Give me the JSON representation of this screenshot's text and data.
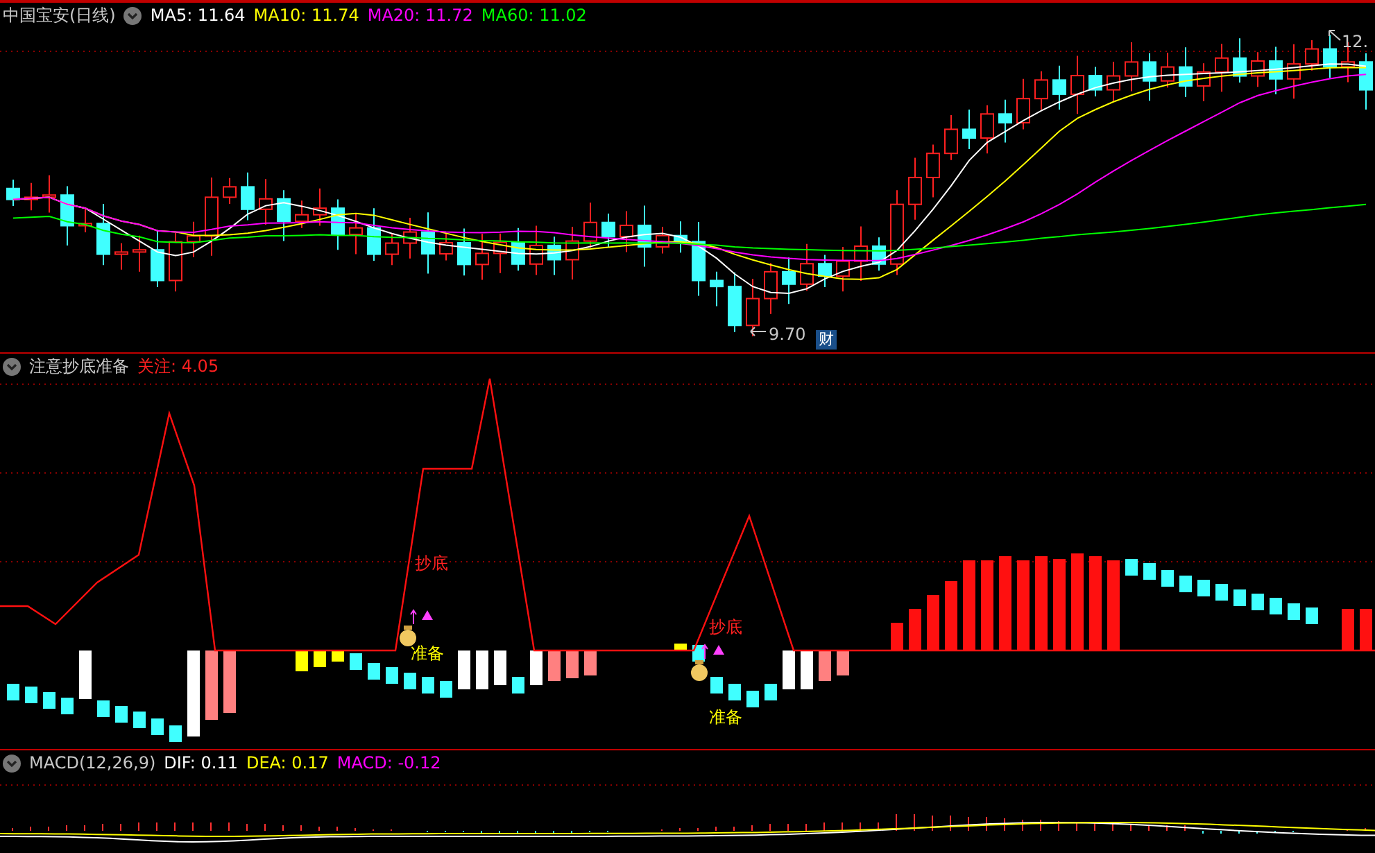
{
  "main_panel": {
    "title": "中国宝安(日线)",
    "indicators": [
      {
        "label": "MA5: 11.64",
        "color": "#ffffff"
      },
      {
        "label": "MA10: 11.74",
        "color": "#ffff00"
      },
      {
        "label": "MA20: 11.72",
        "color": "#ff00ff"
      },
      {
        "label": "MA60: 11.02",
        "color": "#00ff00"
      }
    ],
    "high_label": "12.",
    "low_label": "9.70",
    "finance_badge": "财"
  },
  "signal_panel": {
    "title": "注意抄底准备",
    "reading": "关注: 4.05",
    "labels": [
      {
        "kind": "bottom",
        "text": "抄底"
      },
      {
        "kind": "ready",
        "text": "准备"
      },
      {
        "kind": "bottom",
        "text": "抄底"
      },
      {
        "kind": "ready",
        "text": "准备"
      }
    ]
  },
  "macd_panel": {
    "title": "MACD(12,26,9)",
    "indicators": [
      {
        "label": "DIF: 0.11",
        "color": "#ffffff"
      },
      {
        "label": "DEA: 0.17",
        "color": "#ffff00"
      },
      {
        "label": "MACD: -0.12",
        "color": "#ff00ff"
      }
    ]
  }
}
